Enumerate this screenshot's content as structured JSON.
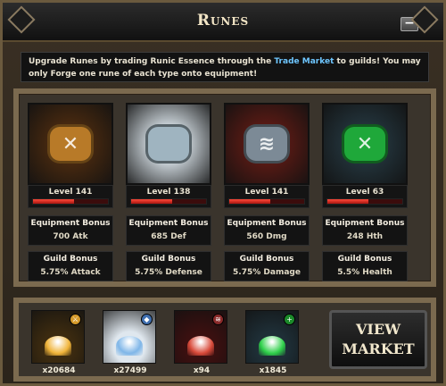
{
  "window": {
    "title": "Runes",
    "minimize_label": "−"
  },
  "notice": {
    "text_before": "Upgrade Runes by trading Runic Essence through the ",
    "link": "Trade Market",
    "text_after": " to guilds! You may only Forge one rune of each type onto equipment!"
  },
  "labels": {
    "equipment_bonus": "Equipment Bonus",
    "guild_bonus": "Guild Bonus"
  },
  "runes": [
    {
      "level": "Level 141",
      "level_fill": 0.55,
      "equipment": "700 Atk",
      "guild": "5.75% Attack",
      "icon": "attack-rune-icon",
      "bg": "#4a2a10",
      "gem": "#b87a28",
      "glyph": "✕"
    },
    {
      "level": "Level 138",
      "level_fill": 0.55,
      "equipment": "685 Def",
      "guild": "5.75% Defense",
      "icon": "defense-rune-icon",
      "bg": "#cfd8de",
      "gem": "#9fb4c0",
      "glyph": ""
    },
    {
      "level": "Level 141",
      "level_fill": 0.55,
      "equipment": "560 Dmg",
      "guild": "5.75% Damage",
      "icon": "damage-rune-icon",
      "bg": "#5a1a14",
      "gem": "#7c8a96",
      "glyph": "≋"
    },
    {
      "level": "Level 63",
      "level_fill": 0.55,
      "equipment": "248 Hth",
      "guild": "5.5% Health",
      "icon": "health-rune-icon",
      "bg": "#23343c",
      "gem": "#1fa83a",
      "glyph": "✕"
    }
  ],
  "essences": [
    {
      "count": "x20684",
      "icon": "attack-essence-icon",
      "bg": "#3b2a10",
      "flame": "#f0b43a",
      "badge": "#d59a2a"
    },
    {
      "count": "x27499",
      "icon": "defense-essence-icon",
      "bg": "#dfe7ee",
      "flame": "#7fb6e8",
      "badge": "#3f6fb0"
    },
    {
      "count": "x94",
      "icon": "damage-essence-icon",
      "bg": "#3a1010",
      "flame": "#d84a3a",
      "badge": "#8a2a2a"
    },
    {
      "count": "x1845",
      "icon": "health-essence-icon",
      "bg": "#1e2e36",
      "flame": "#2fd04a",
      "badge": "#1b8a2a"
    }
  ],
  "view_market": {
    "line1": "VIEW",
    "line2": "MARKET"
  }
}
